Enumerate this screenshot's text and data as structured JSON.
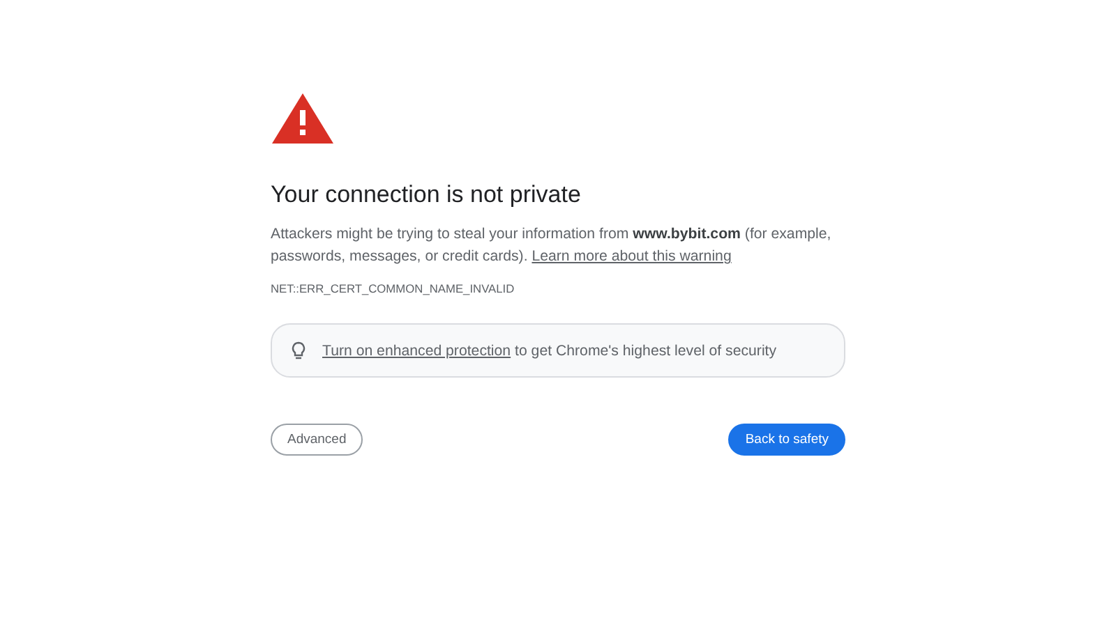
{
  "title": "Your connection is not private",
  "message": {
    "text": "Attackers might be trying to steal your information from **www.bybit.com** (for example, passwords, messages, or credit cards).",
    "link": "Learn more about this warning"
  },
  "error_code": "NET::ERR_CERT_COMMON_NAME_INVALID",
  "protection_banner": {
    "link": "Turn on enhanced protection",
    "text": "to get Chrome's highest level of security"
  },
  "buttons": [
    {
      "label": "Advanced",
      "kind": "secondary"
    },
    {
      "label": "Back to safety",
      "kind": "primary"
    }
  ]
}
